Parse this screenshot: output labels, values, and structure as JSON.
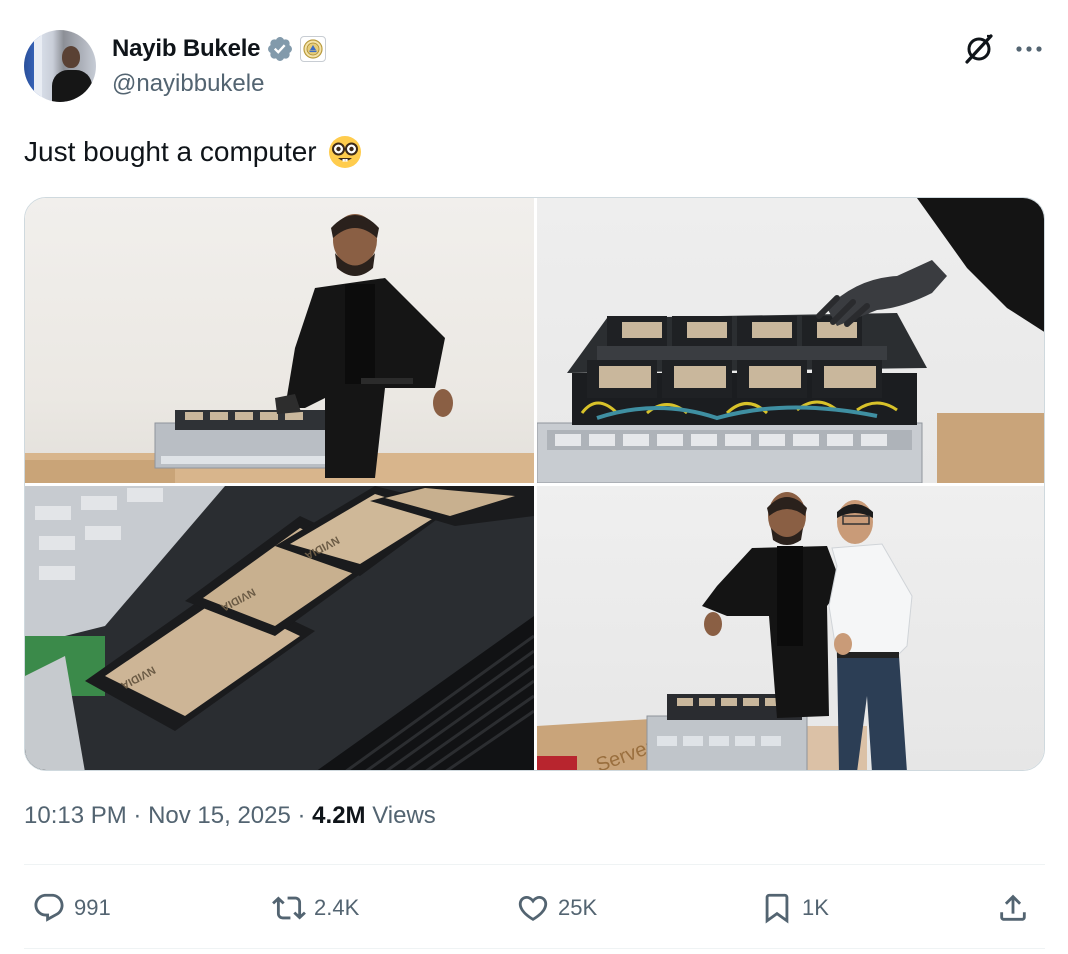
{
  "author": {
    "display_name": "Nayib Bukele",
    "handle": "@nayibbukele",
    "verified": true,
    "verified_color": "#829aab",
    "badge": "affiliation-seal"
  },
  "tweet": {
    "text": "Just bought a computer",
    "emoji": "nerd-face-emoji"
  },
  "media": {
    "count": 4,
    "photos": [
      {
        "name": "photo-man-inspecting-server"
      },
      {
        "name": "photo-gloved-hand-on-gpu-tray"
      },
      {
        "name": "photo-nvidia-gpu-modules-closeup"
      },
      {
        "name": "photo-two-men-pointing-at-server"
      }
    ],
    "photo_caption_text": "Server"
  },
  "meta": {
    "time": "10:13 PM",
    "separator": " · ",
    "date": "Nov 15, 2025",
    "views_count": "4.2M",
    "views_label": "Views"
  },
  "actions": {
    "replies": "991",
    "reposts": "2.4K",
    "likes": "25K",
    "bookmarks": "1K"
  },
  "colors": {
    "text_primary": "#0f1419",
    "text_secondary": "#536471",
    "border": "#cfd9de"
  }
}
